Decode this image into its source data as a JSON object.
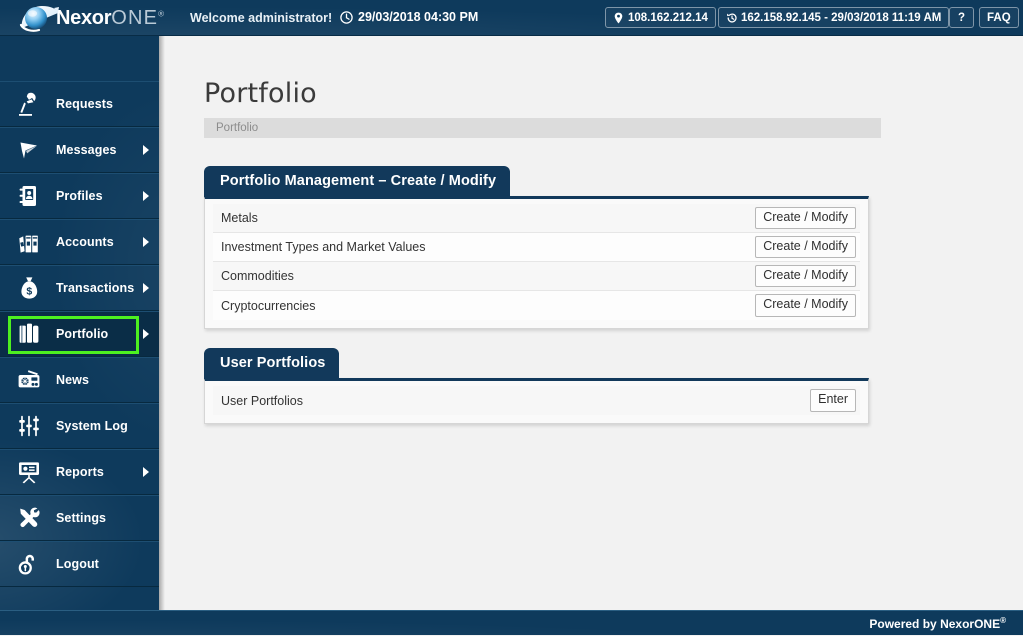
{
  "header": {
    "logo_text_main": "Nexor",
    "logo_text_sub": "ONE",
    "logo_reg": "®",
    "welcome_prefix": "Welcome ",
    "welcome_user": "administrator!",
    "datetime": "29/03/2018 04:30 PM",
    "current_ip": "108.162.212.14",
    "last_login": "162.158.92.145 - 29/03/2018 11:19 AM",
    "help_label": "?",
    "faq_label": "FAQ",
    "icons": {
      "clock": "clock-icon",
      "pin": "location-pin-icon",
      "history": "history-icon"
    }
  },
  "sidebar": {
    "items": [
      {
        "label": "Requests",
        "icon": "desk-lamp-icon",
        "has_arrow": false,
        "active": false
      },
      {
        "label": "Messages",
        "icon": "paper-plane-icon",
        "has_arrow": true,
        "active": false
      },
      {
        "label": "Profiles",
        "icon": "address-book-icon",
        "has_arrow": true,
        "active": false
      },
      {
        "label": "Accounts",
        "icon": "binders-icon",
        "has_arrow": true,
        "active": false
      },
      {
        "label": "Transactions",
        "icon": "money-bag-icon",
        "has_arrow": true,
        "active": false
      },
      {
        "label": "Portfolio",
        "icon": "portfolio-bag-icon",
        "has_arrow": true,
        "active": true
      },
      {
        "label": "News",
        "icon": "radio-icon",
        "has_arrow": false,
        "active": false
      },
      {
        "label": "System Log",
        "icon": "sliders-icon",
        "has_arrow": false,
        "active": false
      },
      {
        "label": "Reports",
        "icon": "presentation-icon",
        "has_arrow": true,
        "active": false
      },
      {
        "label": "Settings",
        "icon": "tools-icon",
        "has_arrow": false,
        "active": false
      },
      {
        "label": "Logout",
        "icon": "padlock-icon",
        "has_arrow": false,
        "active": false
      }
    ],
    "highlight_color": "#4df020"
  },
  "main": {
    "page_title": "Portfolio",
    "breadcrumb": "Portfolio",
    "panels": [
      {
        "tab_title": "Portfolio Management – Create / Modify",
        "rows": [
          {
            "label": "Metals",
            "button": "Create / Modify"
          },
          {
            "label": "Investment Types and Market Values",
            "button": "Create / Modify"
          },
          {
            "label": "Commodities",
            "button": "Create / Modify"
          },
          {
            "label": "Cryptocurrencies",
            "button": "Create / Modify"
          }
        ]
      },
      {
        "tab_title": "User Portfolios",
        "rows": [
          {
            "label": "User Portfolios",
            "button": "Enter"
          }
        ]
      }
    ]
  },
  "footer": {
    "powered_by": "Powered by NexorONE",
    "powered_by_reg": "®"
  },
  "colors": {
    "brand_navy": "#0e3a5c",
    "panel_navy": "#12395b",
    "page_bg": "#f2f2f2",
    "highlight_green": "#4df020"
  }
}
